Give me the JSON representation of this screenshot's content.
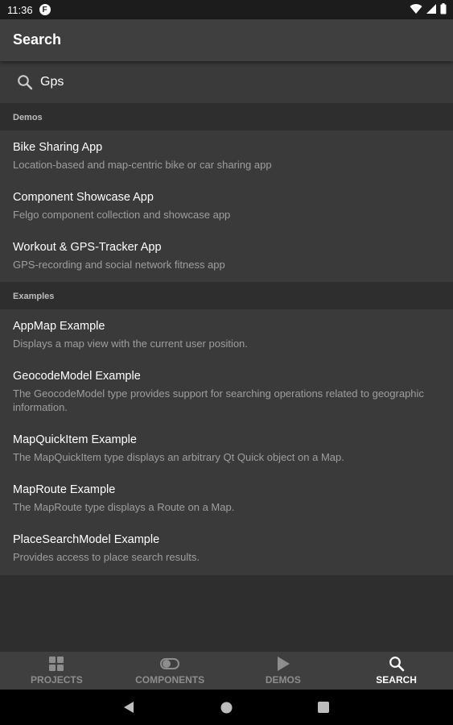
{
  "status": {
    "time": "11:36",
    "app_icon_letter": "F"
  },
  "appbar": {
    "title": "Search"
  },
  "search": {
    "value": "Gps"
  },
  "sections": {
    "demos": {
      "header": "Demos",
      "items": [
        {
          "title": "Bike Sharing App",
          "subtitle": "Location-based and map-centric bike or car sharing app"
        },
        {
          "title": "Component Showcase App",
          "subtitle": "Felgo component collection and showcase app"
        },
        {
          "title": "Workout & GPS-Tracker App",
          "subtitle": "GPS-recording and social network fitness app"
        }
      ]
    },
    "examples": {
      "header": "Examples",
      "items": [
        {
          "title": "AppMap Example",
          "subtitle": "Displays a map view with the current user position."
        },
        {
          "title": "GeocodeModel Example",
          "subtitle": "The GeocodeModel type provides support for searching operations related to geographic information."
        },
        {
          "title": "MapQuickItem Example",
          "subtitle": "The MapQuickItem type displays an arbitrary Qt Quick object on a Map."
        },
        {
          "title": "MapRoute Example",
          "subtitle": "The MapRoute type displays a Route on a Map."
        },
        {
          "title": "PlaceSearchModel Example",
          "subtitle": "Provides access to place search results."
        }
      ]
    }
  },
  "bottom_nav": {
    "tabs": [
      {
        "label": "PROJECTS",
        "icon": "grid-icon",
        "active": false
      },
      {
        "label": "COMPONENTS",
        "icon": "toggle-icon",
        "active": false
      },
      {
        "label": "DEMOS",
        "icon": "play-icon",
        "active": false
      },
      {
        "label": "SEARCH",
        "icon": "search-icon",
        "active": true
      }
    ]
  },
  "colors": {
    "background": "#2e2e2e",
    "appbar": "#3f3f3f",
    "list": "#3a3a3a",
    "text_secondary": "#9e9e9e",
    "tab_inactive": "#8d8d8d",
    "tab_active": "#ffffff"
  }
}
